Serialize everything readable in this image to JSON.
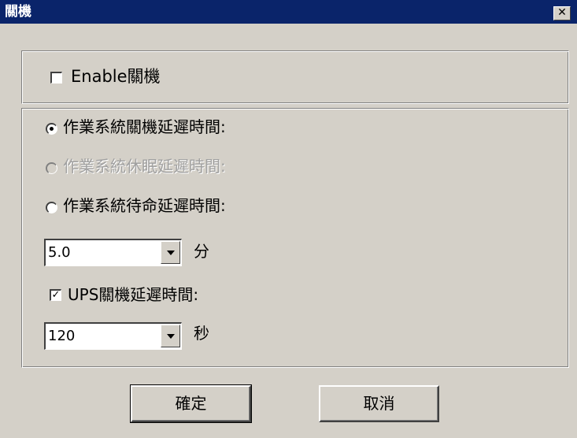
{
  "window": {
    "title": "關機",
    "close_glyph": "✕"
  },
  "enable": {
    "label": "Enable關機",
    "checked": false
  },
  "options": [
    {
      "label": "作業系統關機延遲時間:",
      "selected": true,
      "enabled": true
    },
    {
      "label": "作業系統休眠延遲時間:",
      "selected": false,
      "enabled": false
    },
    {
      "label": "作業系統待命延遲時間:",
      "selected": false,
      "enabled": true
    }
  ],
  "os_delay": {
    "value": "5.0",
    "unit": "分"
  },
  "ups": {
    "label": "UPS關機延遲時間:",
    "checked": true,
    "check_glyph": "✓",
    "value": "120",
    "unit": "秒"
  },
  "buttons": {
    "ok": "確定",
    "cancel": "取消"
  }
}
